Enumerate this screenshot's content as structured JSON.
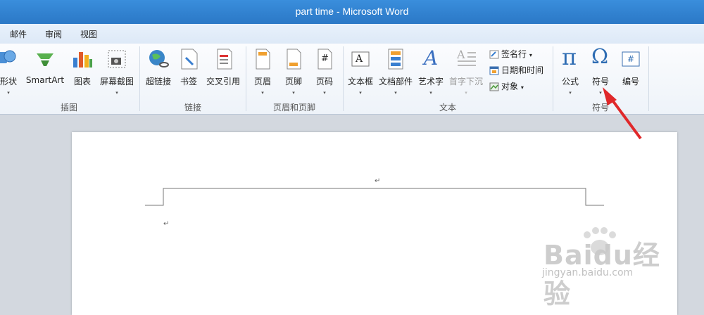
{
  "window": {
    "title": "part time - Microsoft Word"
  },
  "menu": [
    "邮件",
    "审阅",
    "视图"
  ],
  "ribbon": {
    "groups": {
      "illustrations": "插图",
      "links": "链接",
      "header_footer": "页眉和页脚",
      "text": "文本",
      "symbols": "符号"
    },
    "tools": {
      "shapes": "形状",
      "smartart": "SmartArt",
      "chart": "图表",
      "screenshot": "屏幕截图",
      "hyperlink": "超链接",
      "bookmark": "书签",
      "crossref": "交叉引用",
      "header": "页眉",
      "footer": "页脚",
      "pagenum": "页码",
      "textbox": "文本框",
      "quickparts": "文档部件",
      "wordart": "艺术字",
      "dropcap": "首字下沉",
      "signature": "签名行",
      "datetime": "日期和时间",
      "object": "对象",
      "equation": "公式",
      "symbol": "符号",
      "numbering": "编号"
    },
    "glyphs": {
      "pi": "π",
      "omega": "Ω",
      "hash": "#",
      "a_box": "A",
      "a_art": "A",
      "arrow": "▾",
      "para": "↵"
    }
  },
  "colors": {
    "title_bar": "#2b78c6",
    "arrow": "#e0282a"
  },
  "watermark": {
    "brand": "Baidu经验",
    "url": "jingyan.baidu.com"
  }
}
